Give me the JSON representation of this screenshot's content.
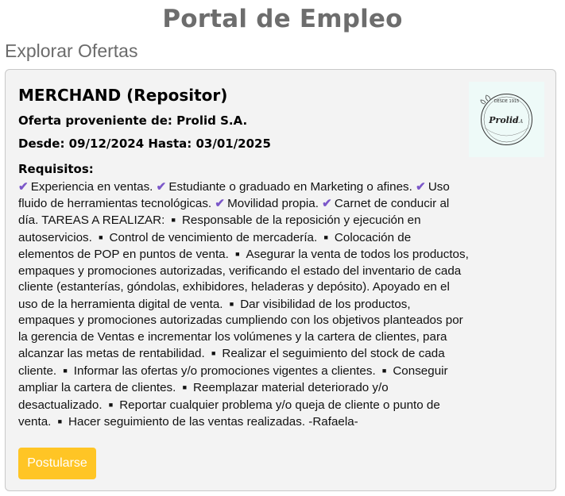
{
  "header": {
    "title": "Portal de Empleo",
    "section_title": "Explorar Ofertas"
  },
  "job": {
    "title": "MERCHAND (Repositor)",
    "company_line": "Oferta proveniente de: Prolid S.A.",
    "dates_line": "Desde: 09/12/2024 Hasta: 03/01/2025",
    "requirements_heading": "Requisitos:",
    "requirements": [
      {
        "icon": "check",
        "text": "Experiencia en ventas."
      },
      {
        "icon": "check",
        "text": "Estudiante o graduado en Marketing o afines."
      },
      {
        "icon": "check",
        "text": "Uso fluido de herramientas tecnológicas."
      },
      {
        "icon": "check",
        "text": "Movilidad propia."
      },
      {
        "icon": "check",
        "text": "Carnet de conducir al día. TAREAS A REALIZAR:"
      },
      {
        "icon": "square",
        "text": "Responsable de la reposición y ejecución en autoservicios."
      },
      {
        "icon": "square",
        "text": "Control de vencimiento de mercadería."
      },
      {
        "icon": "square",
        "text": "Colocación de elementos de POP en puntos de venta."
      },
      {
        "icon": "square",
        "text": "Asegurar la venta de todos los productos, empaques y promociones autorizadas, verificando el estado del inventario de cada cliente (estanterías, góndolas, exhibidores, heladeras y depósito). Apoyado en el uso de la herramienta digital de venta."
      },
      {
        "icon": "square",
        "text": "Dar visibilidad de los productos, empaques y promociones autorizadas cumpliendo con los objetivos planteados por la gerencia de Ventas e incrementar los volúmenes y la cartera de clientes, para alcanzar las metas de rentabilidad."
      },
      {
        "icon": "square",
        "text": "Realizar el seguimiento del stock de cada cliente."
      },
      {
        "icon": "square",
        "text": "Informar las ofertas y/o promociones vigentes a clientes."
      },
      {
        "icon": "square",
        "text": "Conseguir ampliar la cartera de clientes."
      },
      {
        "icon": "square",
        "text": "Reemplazar material deteriorado y/o desactualizado."
      },
      {
        "icon": "square",
        "text": "Reportar cualquier problema y/o queja de cliente o punto de venta."
      },
      {
        "icon": "square",
        "text": "Hacer seguimiento de las ventas realizadas. -Rafaela-"
      }
    ],
    "apply_label": "Postularse",
    "logo": {
      "top_text": "DESDE 1915",
      "brand": "Prolid",
      "brand_suffix": "S.A"
    }
  },
  "colors": {
    "check": "#7b57c9",
    "button": "#ffc525",
    "card_bg": "#f3f3f3",
    "logo_bg": "#eefaf8"
  }
}
